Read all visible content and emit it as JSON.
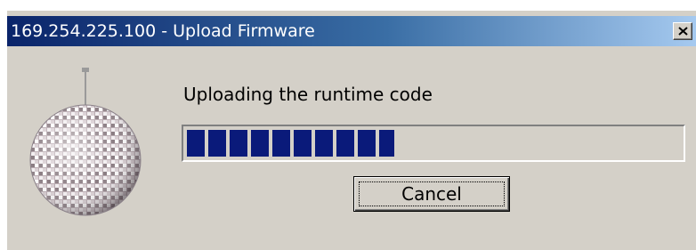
{
  "window": {
    "title": "169.254.225.100 - Upload Firmware",
    "close_icon": "close-icon"
  },
  "dialog": {
    "icon": "disco-ball-icon",
    "message": "Uploading the runtime code",
    "progress": {
      "fraction": 0.42
    },
    "cancel_label": "Cancel"
  },
  "colors": {
    "titlebar_start": "#0a246a",
    "titlebar_end": "#a6caf0",
    "progress_fill": "#0a1a7a",
    "dialog_face": "#d4d0c8"
  }
}
